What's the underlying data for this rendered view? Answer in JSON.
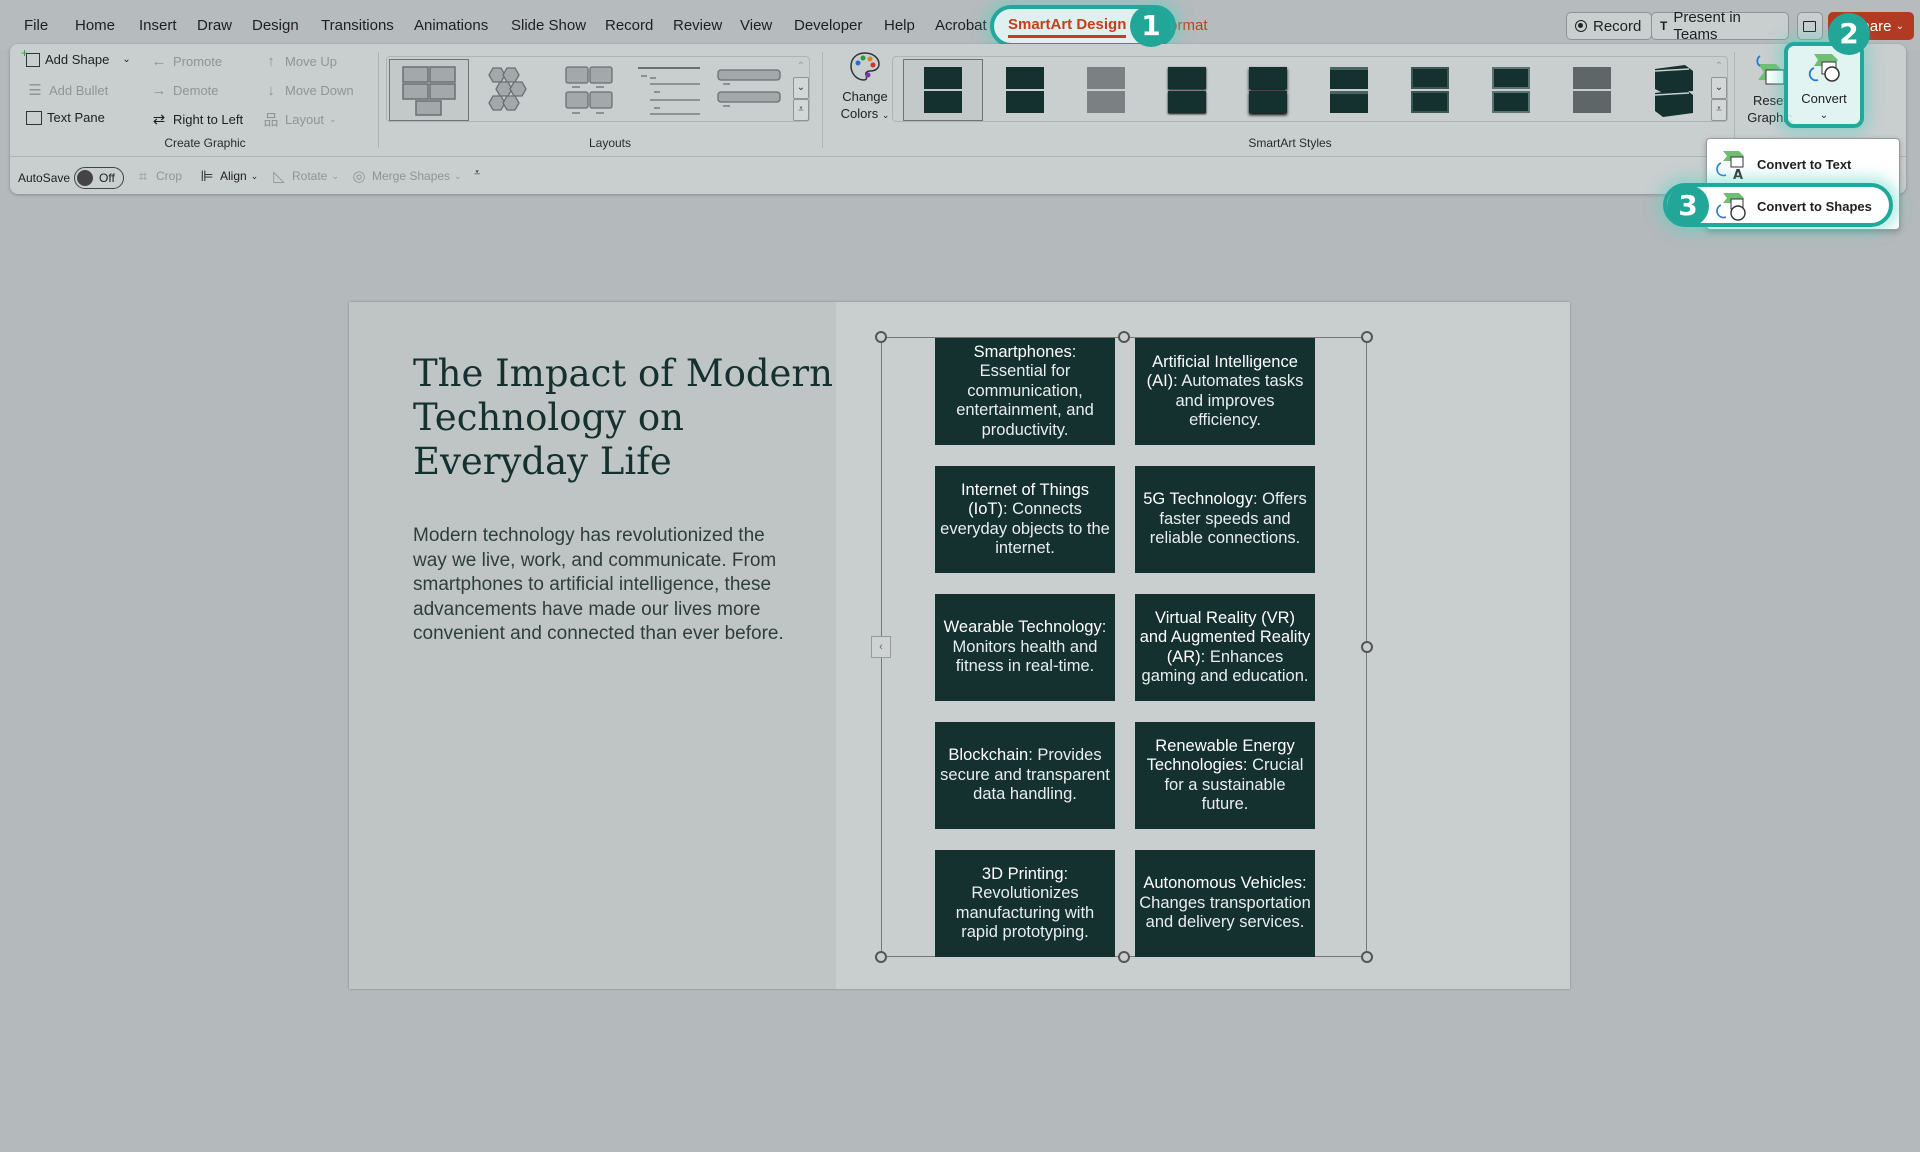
{
  "menu_tabs": [
    "File",
    "Home",
    "Insert",
    "Draw",
    "Design",
    "Transitions",
    "Animations",
    "Slide Show",
    "Record",
    "Review",
    "View",
    "Developer",
    "Help",
    "Acrobat",
    "SmartArt Design",
    "Format"
  ],
  "active_tab": "SmartArt Design",
  "top_right": {
    "record_label": "Record",
    "present_label": "Present in Teams",
    "comments_icon": "comment-icon",
    "share_label": "Share"
  },
  "callouts": [
    "1",
    "2",
    "3"
  ],
  "ribbon": {
    "create_graphic": {
      "label": "Create Graphic",
      "items": [
        {
          "label": "Add Shape",
          "icon": "add-shape-icon",
          "enabled": true,
          "has_dropdown": true
        },
        {
          "label": "Promote",
          "icon": "arrow-left-icon",
          "enabled": false
        },
        {
          "label": "Move Up",
          "icon": "arrow-up-icon",
          "enabled": false
        },
        {
          "label": "Add Bullet",
          "icon": "bullet-list-icon",
          "enabled": false
        },
        {
          "label": "Demote",
          "icon": "arrow-right-icon",
          "enabled": false
        },
        {
          "label": "Move Down",
          "icon": "arrow-down-icon",
          "enabled": false
        },
        {
          "label": "Text Pane",
          "icon": "text-pane-icon",
          "enabled": true
        },
        {
          "label": "Right to Left",
          "icon": "swap-arrows-icon",
          "enabled": true
        },
        {
          "label": "Layout",
          "icon": "org-chart-icon",
          "enabled": false,
          "has_dropdown": true
        }
      ]
    },
    "layouts": {
      "label": "Layouts",
      "items": [
        "grid-blocks-layout",
        "hexagon-cluster-layout",
        "picture-grid-layout",
        "lined-list-layout",
        "bar-list-layout"
      ],
      "selected_index": 0
    },
    "change_colors": {
      "line1": "Change",
      "line2": "Colors"
    },
    "smartart_styles": {
      "label": "SmartArt Styles",
      "count": 10,
      "selected_index": 0
    },
    "reset": {
      "line1": "Reset",
      "line2": "Graphic"
    },
    "convert": {
      "label": "Convert"
    }
  },
  "quick_access": {
    "autosave_label": "AutoSave",
    "autosave_state": "Off",
    "crop": "Crop",
    "align": "Align",
    "rotate": "Rotate",
    "merge_shapes": "Merge Shapes"
  },
  "convert_menu": {
    "items": [
      {
        "label": "Convert to Text",
        "icon": "convert-to-text-icon"
      },
      {
        "label": "Convert to Shapes",
        "icon": "convert-to-shapes-icon",
        "highlighted": true
      }
    ]
  },
  "slide": {
    "title": "The Impact of Modern Technology on Everyday Life",
    "body": "Modern technology has revolutionized the way we live, work, and communicate. From smartphones to artificial intelligence, these advancements have made our lives more convenient and connected than ever before.",
    "smartart": [
      {
        "term": "Smartphones",
        "desc": ": Essential for communication, entertainment, and productivity."
      },
      {
        "term": "Artificial Intelligence (AI)",
        "desc": ": Automates tasks and improves efficiency."
      },
      {
        "term": "Internet of Things (IoT)",
        "desc": ": Connects everyday objects to the internet."
      },
      {
        "term": "5G Technology",
        "desc": ": Offers faster speeds and reliable connections."
      },
      {
        "term": "Wearable Technology",
        "desc": ": Monitors health and fitness in real-time."
      },
      {
        "term": "Virtual Reality (VR) and Augmented Reality (AR)",
        "desc": ": Enhances gaming and education."
      },
      {
        "term": "Blockchain",
        "desc": ": Provides secure and transparent data handling."
      },
      {
        "term": "Renewable Energy Technologies",
        "desc": ": Crucial for a sustainable future."
      },
      {
        "term": "3D Printing",
        "desc": ": Revolutionizes manufacturing with rapid prototyping."
      },
      {
        "term": "Autonomous Vehicles",
        "desc": ": Changes transportation and delivery services."
      }
    ]
  },
  "colors": {
    "accent_red": "#c43e1c",
    "highlight_teal": "#22a698",
    "smartart_fill": "#14302f",
    "title_color": "#14302f"
  }
}
